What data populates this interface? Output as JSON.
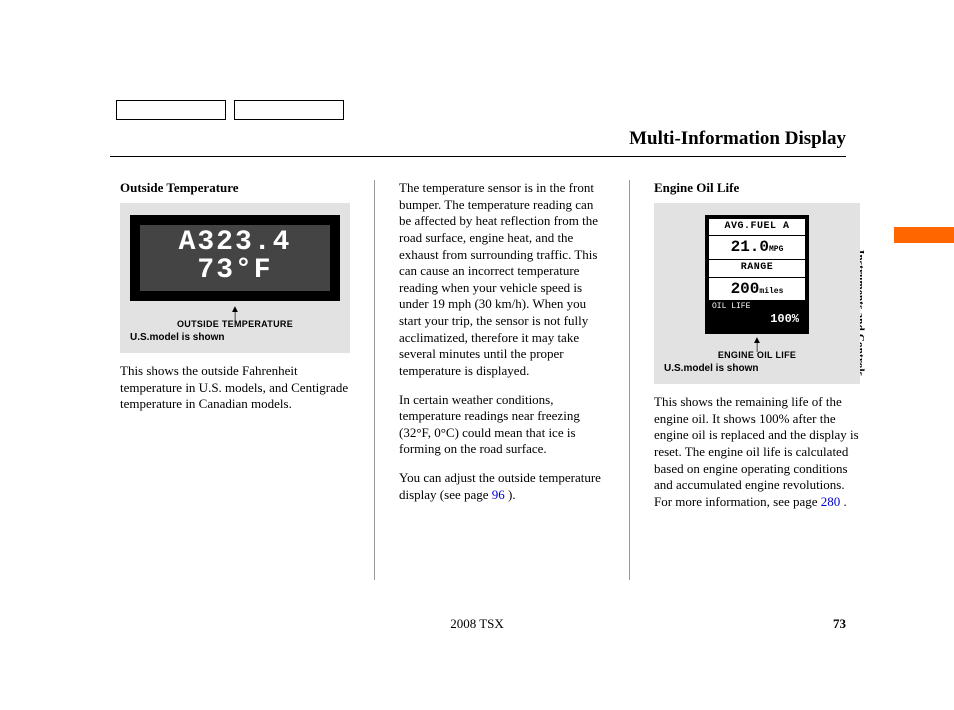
{
  "header": {
    "page_title": "Multi-Information Display",
    "section_label": "Instruments and Controls"
  },
  "col1": {
    "heading": "Outside Temperature",
    "lcd_line1": "A323.4",
    "lcd_line2": "73°F",
    "fig_label": "OUTSIDE TEMPERATURE",
    "fig_note": "U.S.model is shown",
    "p1": "This shows the outside Fahrenheit temperature in U.S. models, and Centigrade temperature in Canadian models."
  },
  "col2": {
    "p1": "The temperature sensor is in the front bumper. The temperature reading can be affected by heat reflection from the road surface, engine heat, and the exhaust from surrounding traffic. This can cause an incorrect temperature reading when your vehicle speed is under 19 mph (30 km/h). When you start your trip, the sensor is not fully acclimatized, therefore it may take several minutes until the proper temperature is displayed.",
    "p2": "In certain weather conditions, temperature readings near freezing (32°F, 0°C) could mean that ice is forming on the road surface.",
    "p3_pre": "You can adjust the outside temperature display (see page ",
    "p3_link": "96",
    "p3_post": " )."
  },
  "col3": {
    "heading": "Engine Oil Life",
    "oil": {
      "avg_fuel_label": "AVG.FUEL A",
      "avg_fuel_value": "21.0",
      "avg_fuel_unit": "MPG",
      "range_label": "RANGE",
      "range_value": "200",
      "range_unit": "miles",
      "oil_life_label": "OIL LIFE",
      "oil_life_value": "100%"
    },
    "fig_label": "ENGINE OIL LIFE",
    "fig_note": "U.S.model is shown",
    "p1_pre": "This shows the remaining life of the engine oil. It shows 100% after the engine oil is replaced and the display is reset. The engine oil life is calculated based on engine operating conditions and accumulated engine revolutions. For more information, see page ",
    "p1_link": "280",
    "p1_post": " ."
  },
  "footer": {
    "model": "2008  TSX",
    "page_number": "73"
  }
}
